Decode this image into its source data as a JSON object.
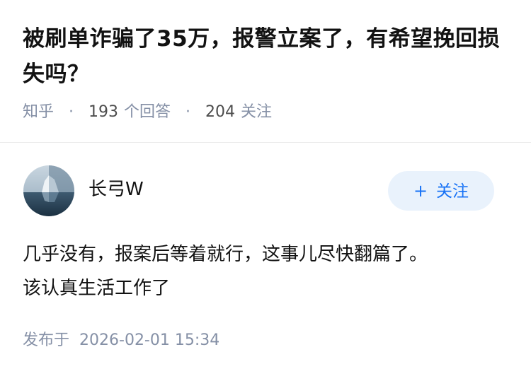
{
  "question": {
    "title": "被刷单诈骗了35万，报警立案了，有希望挽回损失吗？",
    "source": "知乎",
    "answer_count": "193",
    "answer_label": "个回答",
    "follow_count": "204",
    "follow_label": "关注"
  },
  "answer": {
    "author_name": "长弓W",
    "follow_button_label": "关注",
    "follow_button_icon": "plus-icon",
    "paragraphs": [
      "几乎没有，报案后等着就行，这事儿尽快翻篇了。",
      "该认真生活工作了"
    ],
    "publish_label": "发布于",
    "publish_time": "2026-02-01 15:34"
  },
  "colors": {
    "text_primary": "#121212",
    "text_meta": "#8590a6",
    "accent": "#1772f6",
    "button_bg": "#e9f2fc",
    "divider": "#ebebeb"
  }
}
